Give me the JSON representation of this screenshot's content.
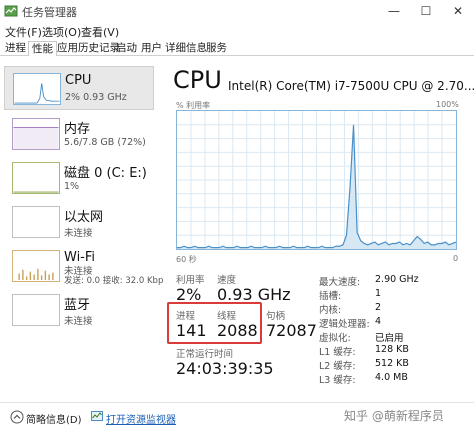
{
  "window": {
    "title": "任务管理器",
    "min": "—",
    "max": "☐",
    "close": "✕"
  },
  "menu": [
    "文件(F)",
    "选项(O)",
    "查看(V)"
  ],
  "tabs": [
    "进程",
    "性能",
    "应用历史记录",
    "启动",
    "用户",
    "详细信息",
    "服务"
  ],
  "sidebar": [
    {
      "title": "CPU",
      "sub": "2% 0.93 GHz"
    },
    {
      "title": "内存",
      "sub": "5.6/7.8 GB (72%)"
    },
    {
      "title": "磁盘 0 (C: E:)",
      "sub": "1%"
    },
    {
      "title": "以太网",
      "sub": "未连接"
    },
    {
      "title": "Wi-Fi",
      "sub": "未连接",
      "sub2": "发送: 0.0  接收: 32.0 Kbp"
    },
    {
      "title": "蓝牙",
      "sub": "未连接"
    }
  ],
  "main": {
    "title": "CPU",
    "model": "Intel(R) Core(TM) i7-7500U CPU @ 2.70...",
    "graph_label": "% 利用率",
    "graph_max": "100%",
    "time_label": "60 秒",
    "time_zero": "0"
  },
  "stats": {
    "util_label": "利用率",
    "util_value": "2%",
    "speed_label": "速度",
    "speed_value": "0.93 GHz",
    "proc_label": "进程",
    "proc_value": "141",
    "thread_label": "线程",
    "thread_value": "2088",
    "handle_label": "句柄",
    "handle_value": "72087",
    "uptime_label": "正常运行时间",
    "uptime_value": "24:03:39:35"
  },
  "specs": [
    {
      "label": "最大速度:",
      "value": "2.90 GHz"
    },
    {
      "label": "插槽:",
      "value": "1"
    },
    {
      "label": "内核:",
      "value": "2"
    },
    {
      "label": "逻辑处理器:",
      "value": "4"
    },
    {
      "label": "虚拟化:",
      "value": "已启用"
    },
    {
      "label": "L1 缓存:",
      "value": "128 KB"
    },
    {
      "label": "L2 缓存:",
      "value": "512 KB"
    },
    {
      "label": "L3 缓存:",
      "value": "4.0 MB"
    }
  ],
  "footer": {
    "brief": "简略信息(D)",
    "resmon": "打开资源监视器",
    "watermark": "知乎 @萌新程序员"
  },
  "colors": {
    "cpu_line": "#4a90c8",
    "cpu_fill": "#d7e8f5",
    "highlight": "#d93a3a",
    "grid": "#dbe8f2"
  },
  "graph_series": [
    1,
    1,
    2,
    1,
    1,
    2,
    1,
    1,
    1,
    2,
    1,
    1,
    1,
    2,
    1,
    1,
    1,
    2,
    1,
    1,
    1,
    2,
    1,
    1,
    1,
    2,
    1,
    1,
    1,
    2,
    1,
    1,
    1,
    2,
    1,
    1,
    1,
    2,
    1,
    1,
    1,
    2,
    1,
    1,
    1,
    2,
    2,
    3,
    10,
    45,
    90,
    12,
    6,
    4,
    3,
    4,
    5,
    3,
    4,
    5,
    3,
    4,
    4,
    5,
    3,
    4,
    3,
    6,
    9,
    7,
    4,
    5,
    3,
    3,
    4,
    4,
    5,
    3,
    4,
    5
  ]
}
